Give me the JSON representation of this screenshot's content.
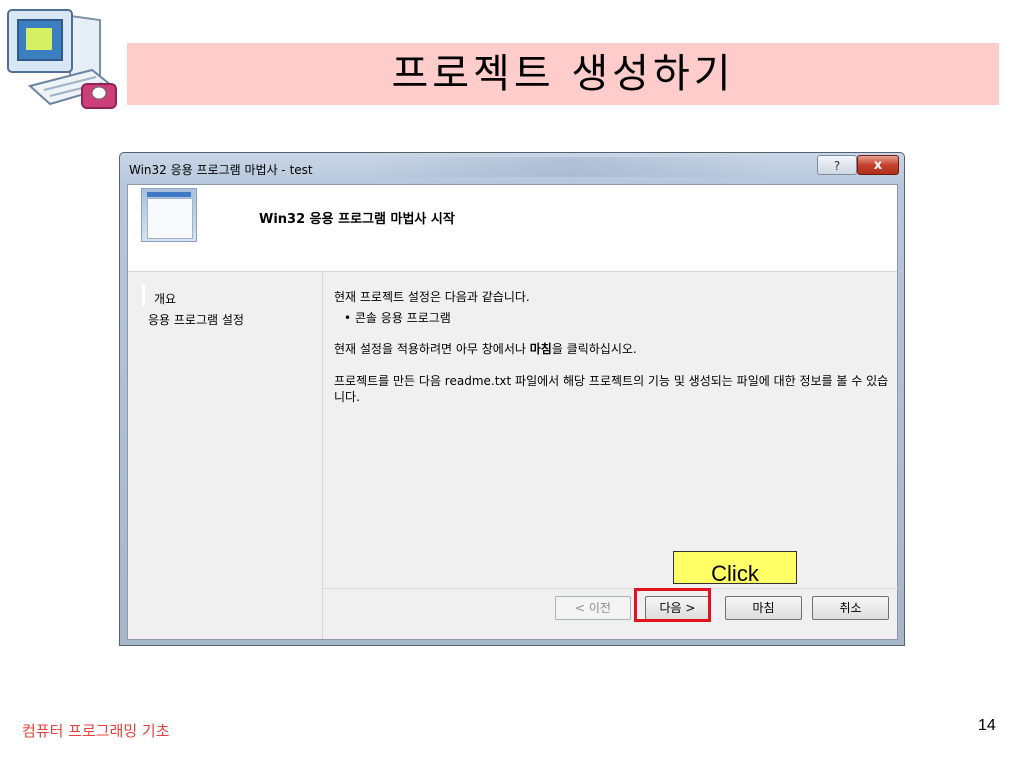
{
  "slide": {
    "title": "프로젝트 생성하기",
    "footer": "컴퓨터 프로그래밍 기초",
    "page_number": "14",
    "title_bar_color": "#ffcccc",
    "icon": "computer-clipart-icon"
  },
  "window": {
    "title": "Win32 응용 프로그램 마법사 - test",
    "help_label": "?",
    "close_label": "x",
    "banner_title": "Win32 응용 프로그램 마법사 시작",
    "banner_icon": "wizard-window-icon"
  },
  "nav": {
    "items": [
      {
        "label": "개요"
      },
      {
        "label": "응용 프로그램 설정"
      }
    ]
  },
  "content": {
    "line1": "현재 프로젝트 설정은 다음과 같습니다.",
    "bullet": "•  콘솔 응용 프로그램",
    "line3_pre": "현재 설정을 적용하려면 아무 창에서나 ",
    "line3_bold": "마침",
    "line3_post": "을 클릭하십시오.",
    "line4": "프로젝트를 만든 다음 readme.txt 파일에서 해당 프로젝트의 기능 및 생성되는 파일에 대한 정보를 볼 수 있습니다."
  },
  "buttons": {
    "prev": "< 이전",
    "next": "다음 >",
    "finish": "마침",
    "cancel": "취소"
  },
  "annotation": {
    "callout": "Click",
    "callout_color": "#ffff66",
    "highlight_color": "#e0141e"
  }
}
